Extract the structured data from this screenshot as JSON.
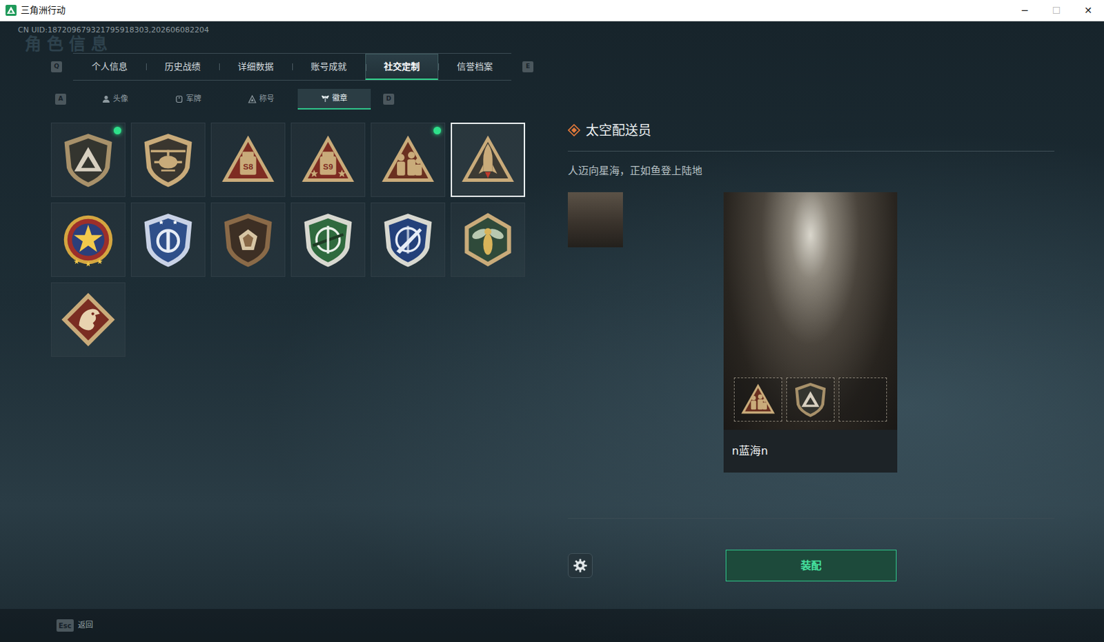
{
  "window": {
    "title": "三角洲行动",
    "controls": [
      {
        "glyph": "─",
        "disabled": false
      },
      {
        "glyph": "☐",
        "disabled": true
      },
      {
        "glyph": "✕",
        "disabled": false
      }
    ]
  },
  "uid": "CN UID:187209679321795918303,202606082204",
  "watermark": "角色信息",
  "tabs": {
    "prev_key": "Q",
    "next_key": "E",
    "items": [
      {
        "label": "个人信息",
        "selected": false
      },
      {
        "label": "历史战绩",
        "selected": false
      },
      {
        "label": "详细数据",
        "selected": false
      },
      {
        "label": "账号成就",
        "selected": false
      },
      {
        "label": "社交定制",
        "selected": true
      },
      {
        "label": "信誉档案",
        "selected": false
      }
    ]
  },
  "subtabs": {
    "prev_key": "A",
    "next_key": "D",
    "items": [
      {
        "label": "头像",
        "kind": "avatar",
        "selected": false
      },
      {
        "label": "军牌",
        "kind": "tag",
        "selected": false
      },
      {
        "label": "称号",
        "kind": "title",
        "selected": false
      },
      {
        "label": "徽章",
        "kind": "badge",
        "selected": true
      }
    ]
  },
  "badges": [
    {
      "kind": "delta",
      "equipped": true,
      "selected": false
    },
    {
      "kind": "heli",
      "equipped": false,
      "selected": false
    },
    {
      "kind": "s8",
      "text": "S8",
      "equipped": false,
      "selected": false
    },
    {
      "kind": "s9",
      "text": "S9",
      "equipped": false,
      "selected": false
    },
    {
      "kind": "squad",
      "equipped": true,
      "selected": false
    },
    {
      "kind": "rocket",
      "equipped": false,
      "selected": true
    },
    {
      "kind": "star",
      "equipped": false,
      "selected": false
    },
    {
      "kind": "eagle",
      "equipped": false,
      "selected": false
    },
    {
      "kind": "gem",
      "equipped": false,
      "selected": false
    },
    {
      "kind": "rifle",
      "equipped": false,
      "selected": false
    },
    {
      "kind": "knife",
      "equipped": false,
      "selected": false
    },
    {
      "kind": "wasp",
      "equipped": false,
      "selected": false
    },
    {
      "kind": "dragon",
      "equipped": false,
      "selected": false
    }
  ],
  "detail": {
    "title": "太空配送员",
    "description": "人迈向星海，正如鱼登上陆地",
    "slots": [
      {
        "kind": "squad"
      },
      {
        "kind": "delta"
      },
      {
        "kind": "empty"
      }
    ],
    "nickname": "n蓝海n",
    "equip_button": "装配"
  },
  "footer": {
    "key": "Esc",
    "label": "返回"
  }
}
